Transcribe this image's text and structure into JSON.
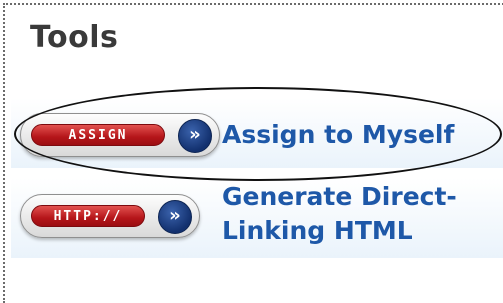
{
  "panel": {
    "title": "Tools"
  },
  "tools": [
    {
      "badge_label": "ASSIGN",
      "icon": "double-chevron-right-icon",
      "link_text": "Assign to Myself"
    },
    {
      "badge_label": "HTTP://",
      "icon": "double-chevron-right-icon",
      "link_text_line1": "Generate Direct-",
      "link_text_line2": "Linking HTML"
    }
  ],
  "colors": {
    "title": "#3a3a3a",
    "link": "#1e58a8",
    "badge_red": "#b5161a",
    "arrow_blue": "#12306e",
    "annotation_oval": "#111111"
  }
}
